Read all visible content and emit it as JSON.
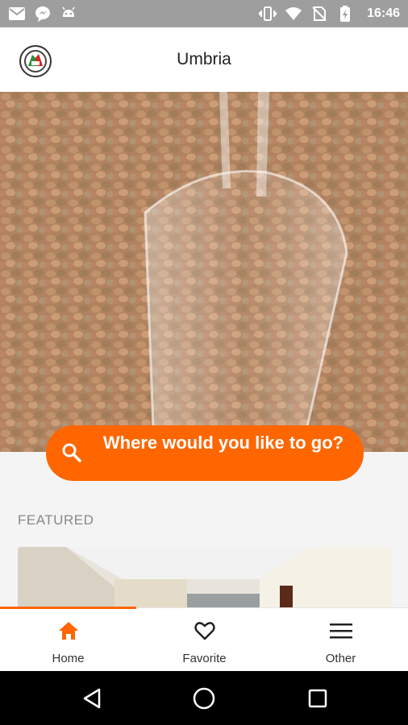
{
  "status_bar": {
    "time": "16:46",
    "left_icons": [
      "gmail-icon",
      "messenger-icon",
      "android-icon"
    ],
    "right_icons": [
      "vibrate-icon",
      "wifi-icon",
      "no-sim-icon",
      "battery-charging-icon"
    ]
  },
  "app_bar": {
    "title": "Umbria",
    "logo_icon": "app-logo-icon"
  },
  "hero": {
    "image": "lentils-in-scoop",
    "search_prompt": "Where would you like to go?",
    "search_icon": "search-icon",
    "accent_color": "#ff6600"
  },
  "featured": {
    "label": "FEATURED",
    "card_image": "interior-room"
  },
  "bottom_nav": {
    "active": "home",
    "items": [
      {
        "id": "home",
        "label": "Home",
        "icon": "home-icon"
      },
      {
        "id": "favorite",
        "label": "Favorite",
        "icon": "heart-icon"
      },
      {
        "id": "other",
        "label": "Other",
        "icon": "menu-icon"
      }
    ]
  },
  "system_nav": {
    "buttons": [
      "back-icon",
      "home-circle-icon",
      "recents-icon"
    ]
  }
}
